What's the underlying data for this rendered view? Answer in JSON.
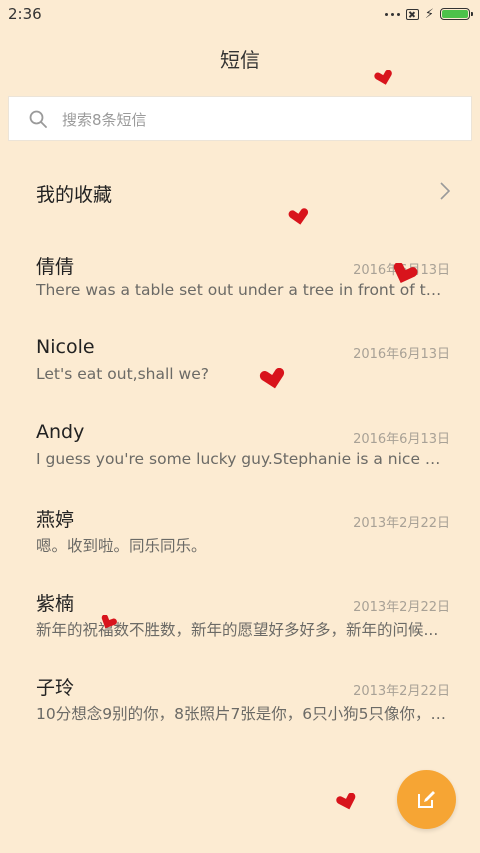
{
  "status_bar": {
    "time": "2:36"
  },
  "header": {
    "title": "短信"
  },
  "search": {
    "placeholder": "搜索8条短信"
  },
  "favorites": {
    "label": "我的收藏"
  },
  "conversations": [
    {
      "name": "倩倩",
      "date": "2016年6月13日",
      "preview": "There was a table set out under a tree in front of the ho..."
    },
    {
      "name": "Nicole",
      "date": "2016年6月13日",
      "preview": "Let's eat out,shall we?"
    },
    {
      "name": "Andy",
      "date": "2016年6月13日",
      "preview": "I guess you're some lucky guy.Stephanie is a nice girl."
    },
    {
      "name": "燕婷",
      "date": "2013年2月22日",
      "preview": "嗯。收到啦。同乐同乐。"
    },
    {
      "name": "紫楠",
      "date": "2013年2月22日",
      "preview": "新年的祝福数不胜数，新年的愿望好多好多，新年的问候..."
    },
    {
      "name": "子玲",
      "date": "2013年2月22日",
      "preview": "10分想念9别的你，8张照片7张是你，6只小狗5只像你，4..."
    }
  ],
  "icons": {
    "search": "search-icon",
    "chevron": "chevron-right-icon",
    "compose": "compose-icon",
    "heart": "heart-icon"
  },
  "colors": {
    "background": "#fcebd2",
    "fab": "#f6a534",
    "heart": "#d8141c",
    "battery": "#4cc24a"
  }
}
